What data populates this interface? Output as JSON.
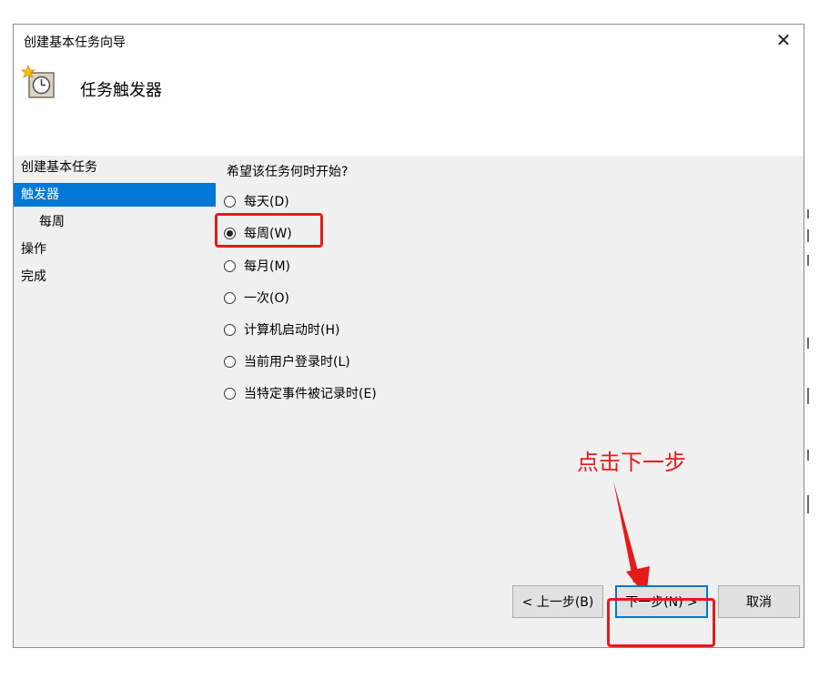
{
  "window": {
    "title": "创建基本任务向导",
    "close_glyph": "✕"
  },
  "header": {
    "label": "任务触发器",
    "icon": "clock-star-icon"
  },
  "sidebar": {
    "items": [
      {
        "label": "创建基本任务",
        "selected": false
      },
      {
        "label": "触发器",
        "selected": true
      },
      {
        "label": "每周",
        "selected": false
      },
      {
        "label": "操作",
        "selected": false
      },
      {
        "label": "完成",
        "selected": false
      }
    ]
  },
  "main": {
    "question": "希望该任务何时开始?",
    "options": [
      {
        "label": "每天(D)",
        "checked": false
      },
      {
        "label": "每周(W)",
        "checked": true
      },
      {
        "label": "每月(M)",
        "checked": false
      },
      {
        "label": "一次(O)",
        "checked": false
      },
      {
        "label": "计算机启动时(H)",
        "checked": false
      },
      {
        "label": "当前用户登录时(L)",
        "checked": false
      },
      {
        "label": "当特定事件被记录时(E)",
        "checked": false
      }
    ]
  },
  "buttons": {
    "back": "< 上一步(B)",
    "next": "下一步(N) >",
    "cancel": "取消"
  },
  "annotation": {
    "text": "点击下一步",
    "color": "#e51a1a"
  },
  "colors": {
    "selection": "#0078d7",
    "highlight": "#e51a1a"
  }
}
